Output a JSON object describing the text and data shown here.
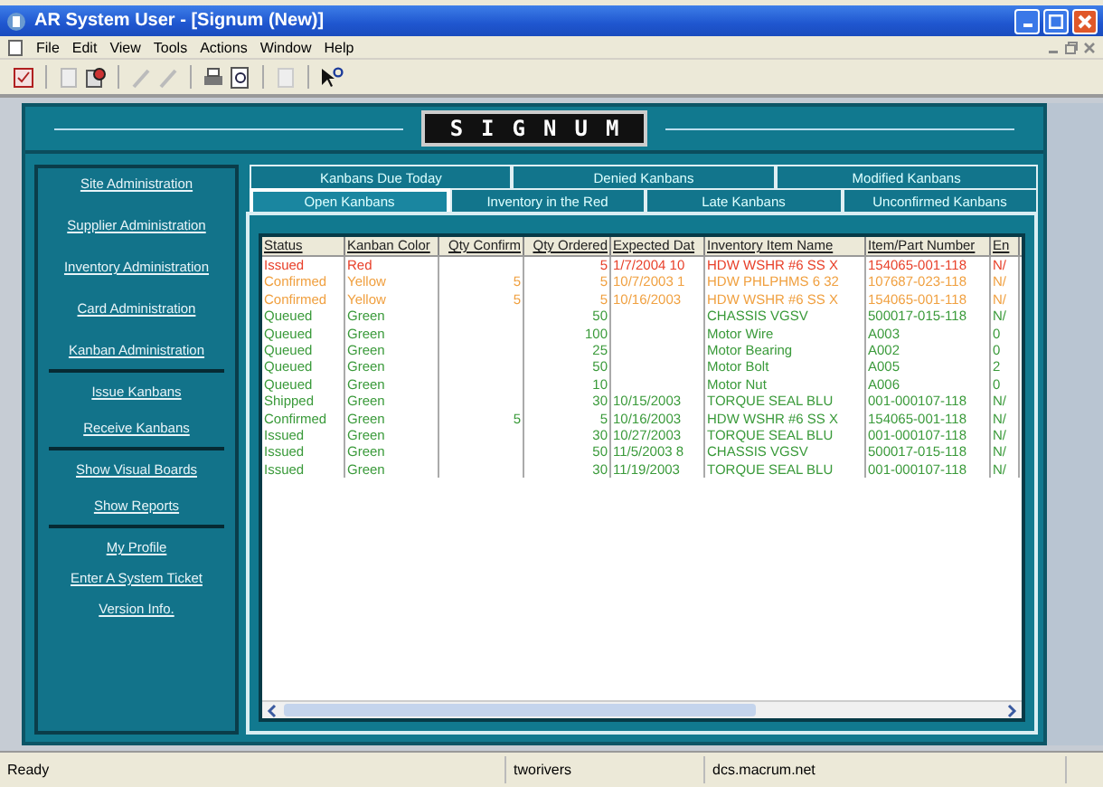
{
  "window": {
    "title": "AR System User - [Signum (New)]"
  },
  "menu": [
    "File",
    "Edit",
    "View",
    "Tools",
    "Actions",
    "Window",
    "Help"
  ],
  "logo": "SIGNUM",
  "nav_groups": [
    {
      "items": [
        "Site Administration",
        "Supplier Administration",
        "Inventory Administration",
        "Card Administration",
        "Kanban Administration"
      ]
    },
    {
      "items": [
        "Issue Kanbans",
        "Receive Kanbans"
      ]
    },
    {
      "items": [
        "Show Visual Boards",
        "Show Reports"
      ]
    },
    {
      "items": [
        "My Profile",
        "Enter A System Ticket",
        "Version Info."
      ]
    }
  ],
  "tab_rows": [
    {
      "tabs": [
        {
          "label": "Kanbans Due Today",
          "selected": false
        },
        {
          "label": "Denied Kanbans",
          "selected": false
        },
        {
          "label": "Modified Kanbans",
          "selected": false
        }
      ]
    },
    {
      "tabs": [
        {
          "label": "Open Kanbans",
          "selected": true
        },
        {
          "label": "Inventory in the Red",
          "selected": false
        },
        {
          "label": "Late Kanbans",
          "selected": false
        },
        {
          "label": "Unconfirmed Kanbans",
          "selected": false
        }
      ]
    }
  ],
  "table": {
    "columns": [
      "Status",
      "Kanban Color",
      "Qty Confirm",
      "Qty Ordered",
      "Expected Dat",
      "Inventory Item Name",
      "Item/Part Number",
      "En"
    ],
    "rows": [
      {
        "color": "#e8402a",
        "cells": [
          "Issued",
          "Red",
          "",
          "5",
          "1/7/2004 10",
          "HDW WSHR #6 SS X",
          "154065-001-118",
          "N/"
        ]
      },
      {
        "color": "#f0a040",
        "cells": [
          "Confirmed",
          "Yellow",
          "5",
          "5",
          "10/7/2003 1",
          "HDW PHLPHMS 6 32",
          "107687-023-118",
          "N/"
        ]
      },
      {
        "color": "#f0a040",
        "cells": [
          "Confirmed",
          "Yellow",
          "5",
          "5",
          "10/16/2003",
          "HDW WSHR #6 SS X",
          "154065-001-118",
          "N/"
        ]
      },
      {
        "color": "#3a9a3a",
        "cells": [
          "Queued",
          "Green",
          "",
          "50",
          "",
          "CHASSIS VGSV",
          "500017-015-118",
          "N/"
        ]
      },
      {
        "color": "#3a9a3a",
        "cells": [
          "Queued",
          "Green",
          "",
          "100",
          "",
          "Motor Wire",
          "A003",
          "0"
        ]
      },
      {
        "color": "#3a9a3a",
        "cells": [
          "Queued",
          "Green",
          "",
          "25",
          "",
          "Motor  Bearing",
          "A002",
          "0"
        ]
      },
      {
        "color": "#3a9a3a",
        "cells": [
          "Queued",
          "Green",
          "",
          "50",
          "",
          "Motor Bolt",
          "A005",
          "2"
        ]
      },
      {
        "color": "#3a9a3a",
        "cells": [
          "Queued",
          "Green",
          "",
          "10",
          "",
          "Motor Nut",
          "A006",
          "0"
        ]
      },
      {
        "color": "#3a9a3a",
        "cells": [
          "Shipped",
          "Green",
          "",
          "30",
          "10/15/2003",
          "TORQUE SEAL BLU",
          "001-000107-118",
          "N/"
        ]
      },
      {
        "color": "#3a9a3a",
        "cells": [
          "Confirmed",
          "Green",
          "5",
          "5",
          "10/16/2003",
          "HDW WSHR #6 SS X",
          "154065-001-118",
          "N/"
        ]
      },
      {
        "color": "#3a9a3a",
        "cells": [
          "Issued",
          "Green",
          "",
          "30",
          "10/27/2003",
          "TORQUE SEAL BLU",
          "001-000107-118",
          "N/"
        ]
      },
      {
        "color": "#3a9a3a",
        "cells": [
          "Issued",
          "Green",
          "",
          "50",
          "11/5/2003 8",
          "CHASSIS VGSV",
          "500017-015-118",
          "N/"
        ]
      },
      {
        "color": "#3a9a3a",
        "cells": [
          "Issued",
          "Green",
          "",
          "30",
          "11/19/2003",
          "TORQUE SEAL BLU",
          "001-000107-118",
          "N/"
        ]
      }
    ]
  },
  "status_bar": [
    "Ready",
    "tworivers",
    "dcs.macrum.net"
  ]
}
